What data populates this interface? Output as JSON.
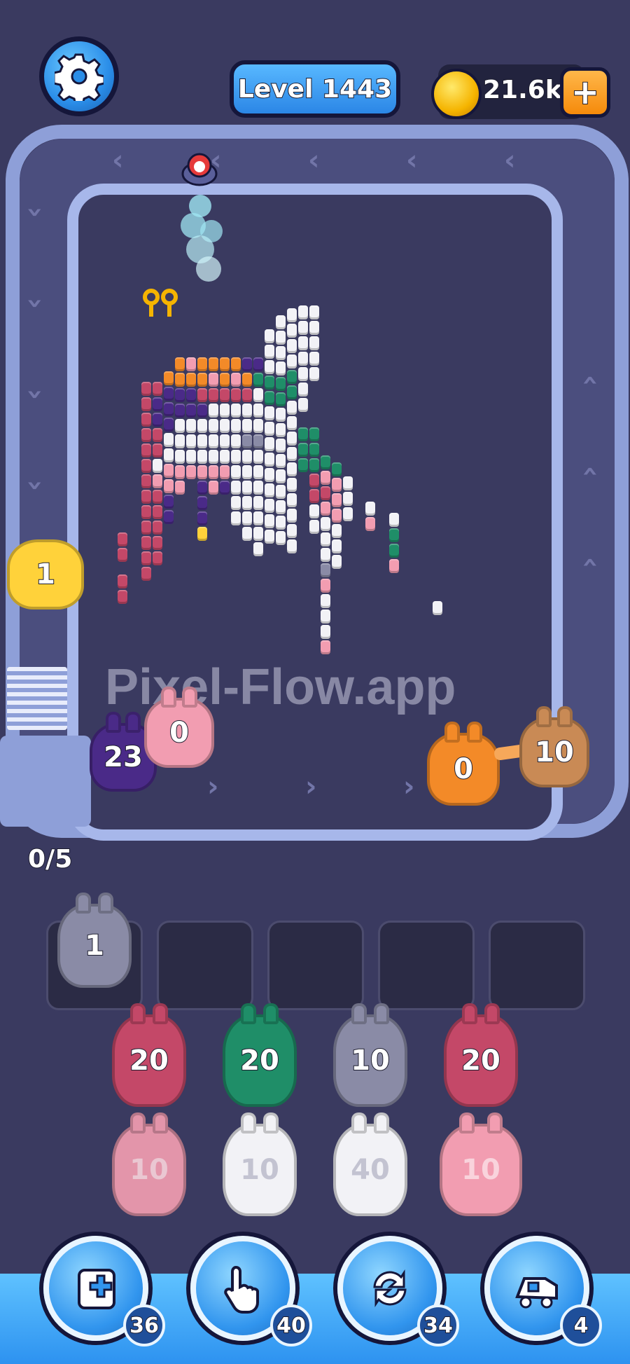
{
  "header": {
    "level_label": "Level 1443",
    "coins": "21.6k",
    "coin_plus": "+"
  },
  "watermark": "Pixel-Flow.app",
  "conveyor": {
    "entry_yellow": "1",
    "pig_purple": "23",
    "pig_pink": "0",
    "pig_orange": "0",
    "pig_tan": "10"
  },
  "queue_counter": "0/5",
  "slots": [
    {
      "value": "1",
      "color": "#8a8ba6"
    }
  ],
  "grid": {
    "row1": [
      {
        "value": "20",
        "color": "#c44868"
      },
      {
        "value": "20",
        "color": "#1f8e68"
      },
      {
        "value": "10",
        "color": "#8a8ba6"
      },
      {
        "value": "20",
        "color": "#c44868"
      }
    ],
    "row2": [
      {
        "value": "10",
        "color": "#f29db1"
      },
      {
        "value": "10",
        "color": "#f2f2f6"
      },
      {
        "value": "40",
        "color": "#f2f2f6"
      },
      {
        "value": "10",
        "color": "#f29db1"
      }
    ]
  },
  "tools": [
    {
      "icon": "add-block-icon",
      "count": "36"
    },
    {
      "icon": "hand-pointer-icon",
      "count": "40"
    },
    {
      "icon": "shuffle-icon",
      "count": "34"
    },
    {
      "icon": "train-icon",
      "count": "4"
    }
  ],
  "colors": {
    "pink": "#f29db1",
    "magenta": "#c44868",
    "purple": "#4a2a88",
    "orange": "#f38a28",
    "tan": "#c98a55",
    "yellow": "#ffd23a",
    "green": "#1f8e68",
    "white": "#f2f2f6",
    "grey": "#8a8ba6"
  }
}
